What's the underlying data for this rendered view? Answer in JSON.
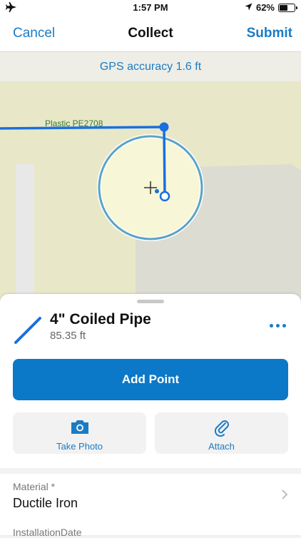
{
  "status_bar": {
    "time": "1:57 PM",
    "battery": "62%",
    "battery_level": 0.62,
    "icons": [
      "airplane-icon",
      "location-arrow-icon",
      "battery-icon"
    ]
  },
  "nav": {
    "cancel": "Cancel",
    "title": "Collect",
    "submit": "Submit"
  },
  "gps": {
    "accuracy_text": "GPS accuracy 1.6 ft"
  },
  "map": {
    "pipe_label": "Plastic PE2708",
    "colors": {
      "background": "#e8e8c9",
      "building": "#dcdcd2",
      "road": "#e6e6e6",
      "line": "#1a6fe0",
      "accuracy_fill": "#f7f6d6",
      "accuracy_ring": "#5ba3c7"
    }
  },
  "feature": {
    "title": "4\" Coiled Pipe",
    "length": "85.35 ft"
  },
  "actions": {
    "add_point": "Add Point",
    "take_photo": "Take Photo",
    "attach": "Attach"
  },
  "form": {
    "material_label": "Material *",
    "material_value": "Ductile Iron",
    "installation_label": "InstallationDate"
  },
  "colors": {
    "accent": "#1a7cc5",
    "button": "#0b78c8"
  }
}
